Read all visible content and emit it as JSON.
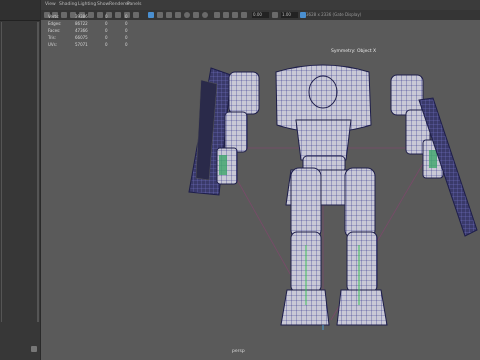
{
  "menubar": {
    "items": [
      "View",
      "Shading",
      "Lighting",
      "Show",
      "Renderer",
      "Panels"
    ]
  },
  "toolbar": {
    "field1_value": "0.00",
    "field2_value": "1.00",
    "resolution_gate": "3628 x 2336 (Gate Display)"
  },
  "hud": {
    "rows": [
      {
        "label": "Verts:",
        "c1": "39386",
        "c2": "0",
        "c3": "0"
      },
      {
        "label": "Edges:",
        "c1": "86722",
        "c2": "0",
        "c3": "0"
      },
      {
        "label": "Faces:",
        "c1": "47366",
        "c2": "0",
        "c3": "0"
      },
      {
        "label": "Tris:",
        "c1": "66075",
        "c2": "0",
        "c3": "0"
      },
      {
        "label": "UVs:",
        "c1": "57071",
        "c2": "0",
        "c3": "0"
      }
    ]
  },
  "viewport": {
    "object_label": "Symmetry: Object X",
    "camera_label": "persp",
    "background_color": "#5a5a5a",
    "wireframe_color": "#2c2c8a"
  },
  "left_panel": {
    "background_color": "#373737"
  }
}
